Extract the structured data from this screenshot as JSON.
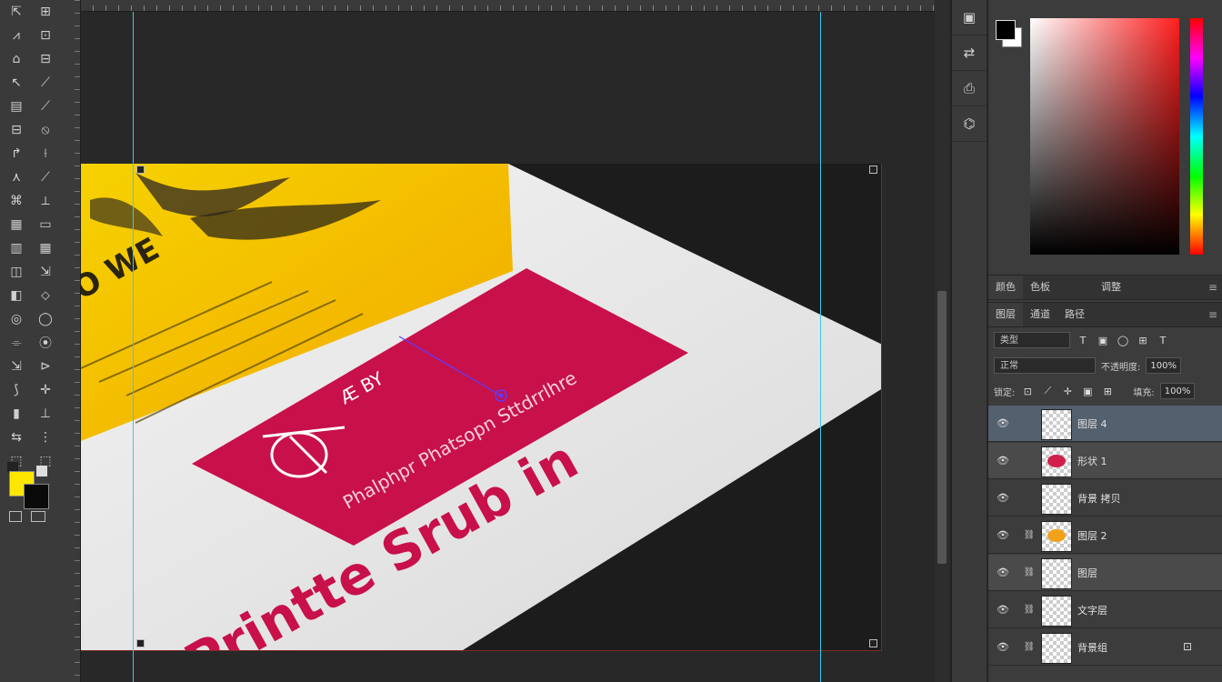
{
  "tools": {
    "left": [
      "⇱",
      "⩘",
      "⌂",
      "↖",
      "▤",
      "⊟",
      "↱",
      "⋏",
      "⌘",
      "▦",
      "▥",
      "◫",
      "◧",
      "◎",
      "⌯",
      "⇲",
      "⟆",
      "▮",
      "⇆",
      "⬚"
    ],
    "right": [
      "⊞",
      "⊡",
      "⊟",
      "⟋",
      "⟋",
      "⦸",
      "⟊",
      "⟋",
      "⟂",
      "▭",
      "▦",
      "⇲",
      "⬦",
      "◯",
      "⦿",
      "⊳",
      "✛",
      "⊥",
      "⋮",
      "⬚"
    ],
    "foreground_color": "#ffe600",
    "background_color": "#0a0a0a",
    "swatch_small_a": "#222222",
    "swatch_small_b": "#dddddd"
  },
  "document": {
    "photo": {
      "poster_text_big": "Printte Srub in",
      "poster_text_small": "Phalphpr Phatsopn Sttdrrlhre",
      "poster_text_logo": "Æ BY",
      "poster_text_corner": "O WE"
    }
  },
  "dock": {
    "icons": [
      "▣",
      "⇄",
      "⎙",
      "⌬"
    ]
  },
  "panels": {
    "color": {
      "fg": "#000000",
      "bg": "#ffffff"
    },
    "tabs_top": [
      "颜色",
      "色板",
      "调整"
    ],
    "tabs_layers": [
      "图层",
      "通道",
      "路径"
    ],
    "filter_label": "类型",
    "filter_icons": [
      "T",
      "▣",
      "◯",
      "⊞",
      "T"
    ],
    "blend_mode": "正常",
    "opacity_label": "不透明度:",
    "opacity_value": "100%",
    "lock_label": "锁定:",
    "lock_icons": [
      "⊡",
      "⟋",
      "✛",
      "▣",
      "⊞"
    ],
    "fill_label": "填充:",
    "fill_value": "100%",
    "menu_icon": "≡"
  },
  "layers": [
    {
      "name": "图层 4",
      "thumb": "empty",
      "selected": true,
      "link": ""
    },
    {
      "name": "形状 1",
      "thumb": "red",
      "selected": false,
      "link": ""
    },
    {
      "name": "背景 拷贝",
      "thumb": "empty",
      "selected": false,
      "link": ""
    },
    {
      "name": "图层 2",
      "thumb": "orange",
      "selected": false,
      "link": "⛓"
    },
    {
      "name": "图层",
      "thumb": "empty",
      "selected": false,
      "link": "⛓"
    },
    {
      "name": "文字层",
      "thumb": "empty",
      "selected": false,
      "link": "⛓"
    },
    {
      "name": "背景组",
      "thumb": "empty",
      "selected": false,
      "link": "⛓",
      "lock": "⊡"
    }
  ]
}
